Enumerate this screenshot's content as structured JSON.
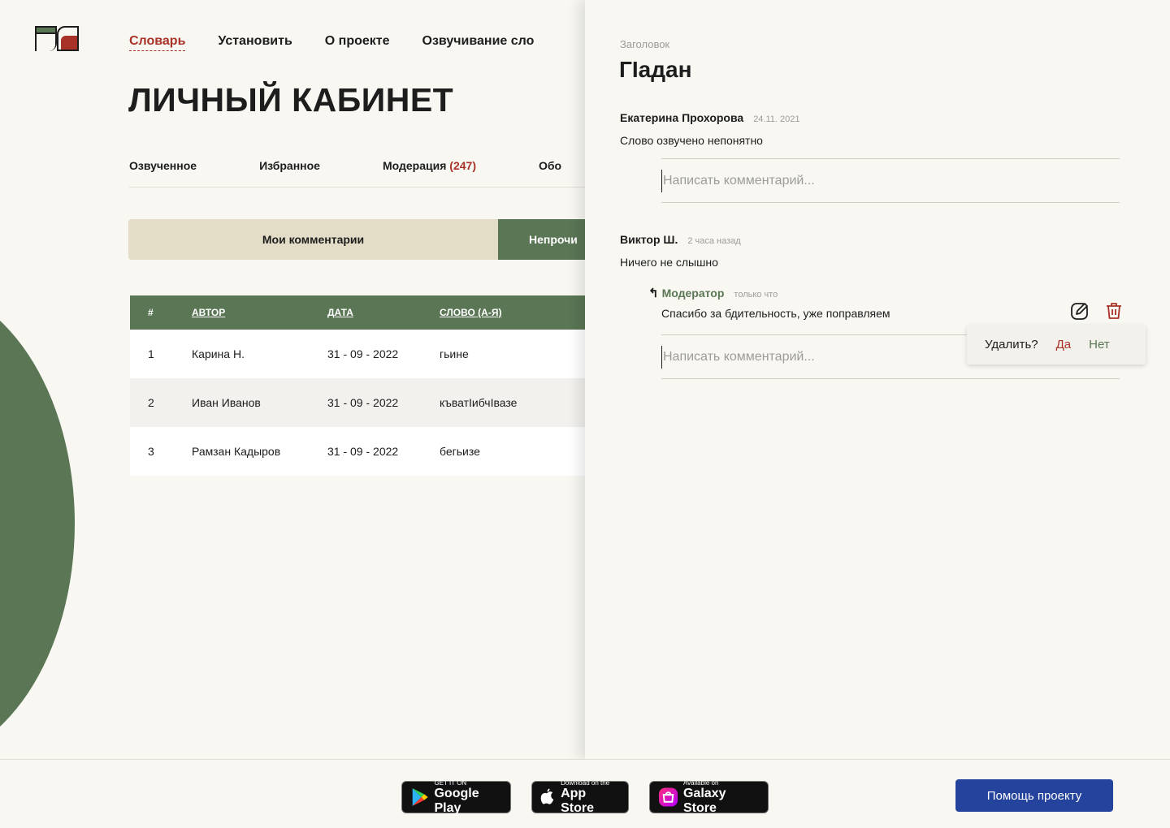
{
  "nav": {
    "items": [
      "Словарь",
      "Установить",
      "О проекте",
      "Озвучивание сло"
    ]
  },
  "page_title": "ЛИЧНЫЙ КАБИНЕТ",
  "tabs": {
    "voiced": "Озвученное",
    "favorites": "Избранное",
    "moderation": "Модерация",
    "moderation_count": "(247)",
    "other": "Обо"
  },
  "segment": {
    "my_comments": "Мои комментарии",
    "unread": "Непрочи"
  },
  "table": {
    "headers": [
      "#",
      "АВТОР",
      "ДАТА",
      "СЛОВО (А-Я)"
    ],
    "rows": [
      [
        "1",
        "Карина Н.",
        "31 - 09 - 2022",
        "гьине"
      ],
      [
        "2",
        "Иван Иванов",
        "31 - 09 - 2022",
        "къватІибчІвазе"
      ],
      [
        "3",
        "Рамзан Кадыров",
        "31 - 09 - 2022",
        "бегьизе"
      ]
    ]
  },
  "drawer": {
    "label": "Заголовок",
    "title": "ГІадан",
    "reply_placeholder": "Написать комментарий...",
    "comments": [
      {
        "author": "Екатерина Прохорова",
        "date": "24.11. 2021",
        "text": "Слово озвучено непонятно"
      },
      {
        "author": "Виктор Ш.",
        "date": "2 часа назад",
        "text": "Ничего не слышно"
      }
    ],
    "reply": {
      "author": "Модератор",
      "date": "только что",
      "text": "Спасибо за бдительность, уже поправляем"
    },
    "delete_popup": {
      "question": "Удалить?",
      "yes": "Да",
      "no": "Нет"
    }
  },
  "footer": {
    "google_play": {
      "small": "GET IT ON",
      "big": "Google Play"
    },
    "app_store": {
      "small": "Download on the",
      "big": "App Store"
    },
    "galaxy_store": {
      "small": "Available on",
      "big": "Galaxy Store"
    },
    "help_button": "Помощь проекту"
  },
  "colors": {
    "green": "#5a7654",
    "red": "#a83227",
    "blue": "#24439c",
    "beige": "#e3dcc7"
  },
  "icons": [
    "logo",
    "reply-arrow-icon",
    "edit-icon",
    "trash-icon",
    "google-play-icon",
    "apple-icon",
    "galaxy-store-icon"
  ]
}
